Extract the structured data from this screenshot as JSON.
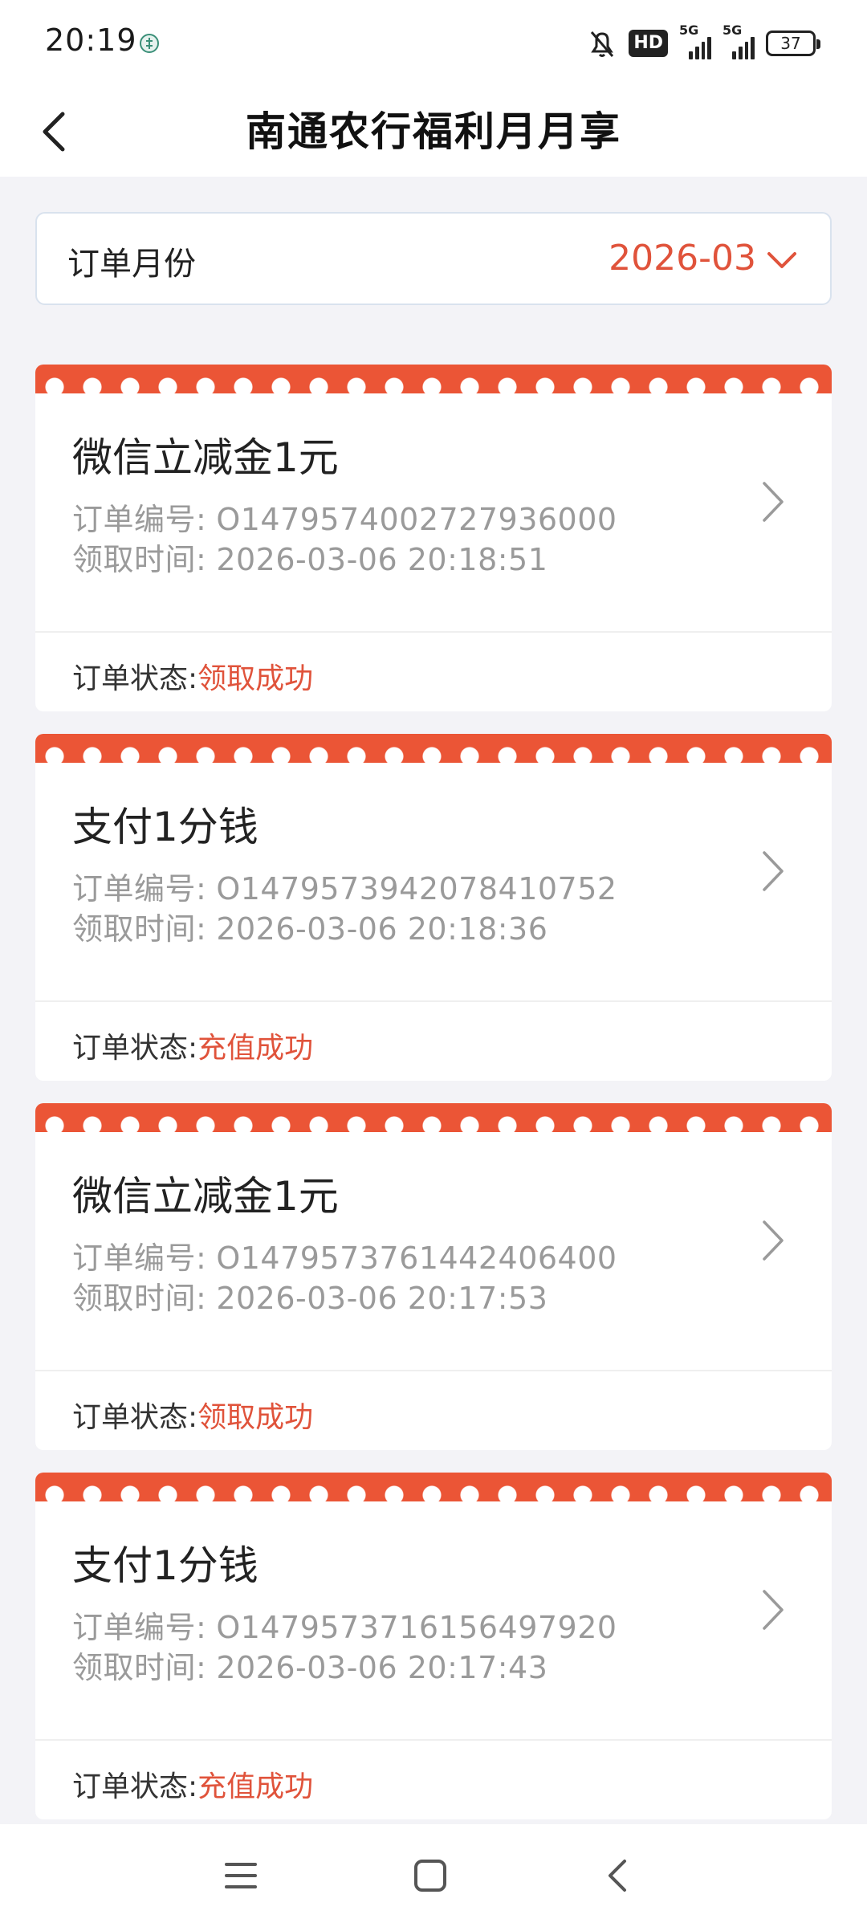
{
  "status_bar": {
    "time": "20:19",
    "hd_label": "HD",
    "network_1": "5G",
    "network_2": "5G",
    "battery": "37",
    "icons": [
      "app-notification-icon",
      "mute-bell-icon",
      "hd-icon",
      "signal-icon",
      "signal-icon",
      "battery-icon"
    ]
  },
  "header": {
    "title": "南通农行福利月月享",
    "back_icon": "chevron-left-icon"
  },
  "filter": {
    "label": "订单月份",
    "value": "2026-03",
    "dropdown_icon": "chevron-down-icon"
  },
  "orders": [
    {
      "title": "微信立减金1元",
      "order_no_label": "订单编号:",
      "order_no": "O1479574002727936000",
      "time_label": "领取时间:",
      "time": "2026-03-06 20:18:51",
      "status_label": "订单状态:",
      "status": "领取成功"
    },
    {
      "title": "支付1分钱",
      "order_no_label": "订单编号:",
      "order_no": "O1479573942078410752",
      "time_label": "领取时间:",
      "time": "2026-03-06 20:18:36",
      "status_label": "订单状态:",
      "status": "充值成功"
    },
    {
      "title": "微信立减金1元",
      "order_no_label": "订单编号:",
      "order_no": "O1479573761442406400",
      "time_label": "领取时间:",
      "time": "2026-03-06 20:17:53",
      "status_label": "订单状态:",
      "status": "领取成功"
    },
    {
      "title": "支付1分钱",
      "order_no_label": "订单编号:",
      "order_no": "O1479573716156497920",
      "time_label": "领取时间:",
      "time": "2026-03-06 20:17:43",
      "status_label": "订单状态:",
      "status": "充值成功"
    }
  ],
  "colors": {
    "accent": "#e0533b",
    "card_header": "#eb5536",
    "background": "#f3f3f7"
  },
  "system_nav": {
    "icons": [
      "menu-icon",
      "home-icon",
      "back-icon"
    ]
  }
}
